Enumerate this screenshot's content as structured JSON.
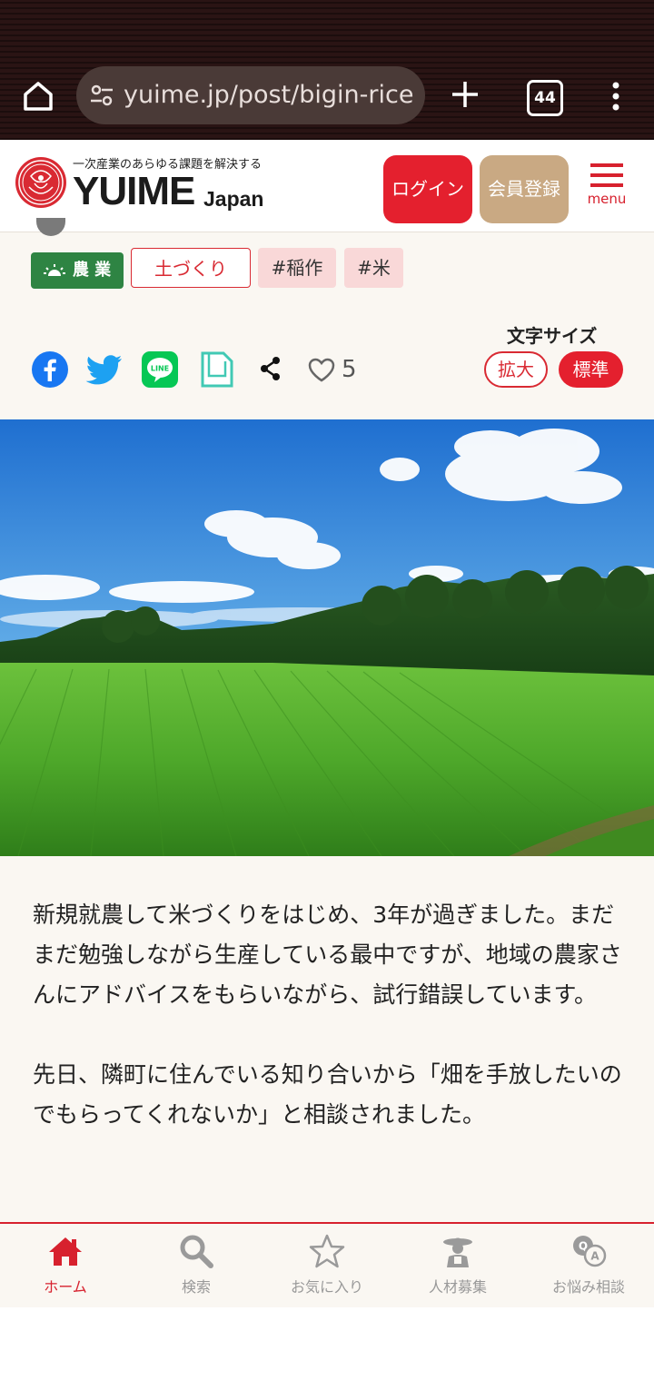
{
  "browser": {
    "url": "yuime.jp/post/bigin-rice-fa",
    "tab_count": "44"
  },
  "header": {
    "tagline": "一次産業のあらゆる課題を解決する",
    "brand": "YUIME",
    "brand_sub": "Japan",
    "login_label": "ログイン",
    "register_label": "会員登録",
    "menu_label": "menu"
  },
  "tags": {
    "category": "農 業",
    "soil": "土づくり",
    "ine": "#稲作",
    "kome": "#米"
  },
  "font_size": {
    "label": "文字サイズ",
    "large": "拡大",
    "standard": "標準"
  },
  "share": {
    "like_count": "5"
  },
  "article": {
    "paragraph1": "新規就農して米づくりをはじめ、3年が過ぎました。まだまだ勉強しながら生産している最中ですが、地域の農家さんにアドバイスをもらいながら、試行錯誤しています。",
    "paragraph2": "先日、隣町に住んでいる知り合いから「畑を手放したいのでもらってくれないか」と相談されました。"
  },
  "bottom_nav": {
    "home": "ホーム",
    "search": "検索",
    "favorites": "お気に入り",
    "recruit": "人材募集",
    "consult": "お悩み相談"
  },
  "colors": {
    "brand_red": "#e4202e",
    "register_tan": "#c9a983",
    "agri_green": "#2e8443",
    "tag_pink": "#f9d8d8"
  }
}
